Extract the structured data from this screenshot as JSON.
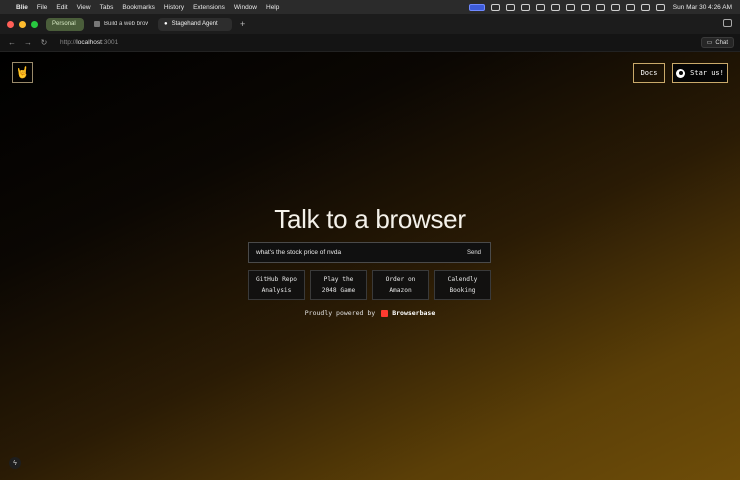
{
  "menubar": {
    "app_name": "Blie",
    "items": [
      "File",
      "Edit",
      "View",
      "Tabs",
      "Bookmarks",
      "History",
      "Extensions",
      "Window",
      "Help"
    ],
    "clock": "Sun Mar 30  4:26 AM"
  },
  "tabs": [
    {
      "label": "Personal"
    },
    {
      "label": "Build a web browsing a"
    },
    {
      "label": "Stagehand Agent"
    }
  ],
  "address": {
    "prefix": "http://",
    "host": "localhost",
    "port": ":3001"
  },
  "chat_button": {
    "label": "Chat"
  },
  "page": {
    "logo_glyph": "🤘",
    "docs_label": "Docs",
    "star_label": "Star us!",
    "headline": "Talk to a browser",
    "input": {
      "value": "what's the stock price of nvda",
      "send_label": "Send"
    },
    "suggestions": [
      {
        "label": "GitHub Repo\nAnalysis"
      },
      {
        "label": "Play the\n2048 Game"
      },
      {
        "label": "Order on\nAmazon"
      },
      {
        "label": "Calendly\nBooking"
      }
    ],
    "powered_text": "Proudly powered by",
    "powered_brand": "Browserbase"
  }
}
